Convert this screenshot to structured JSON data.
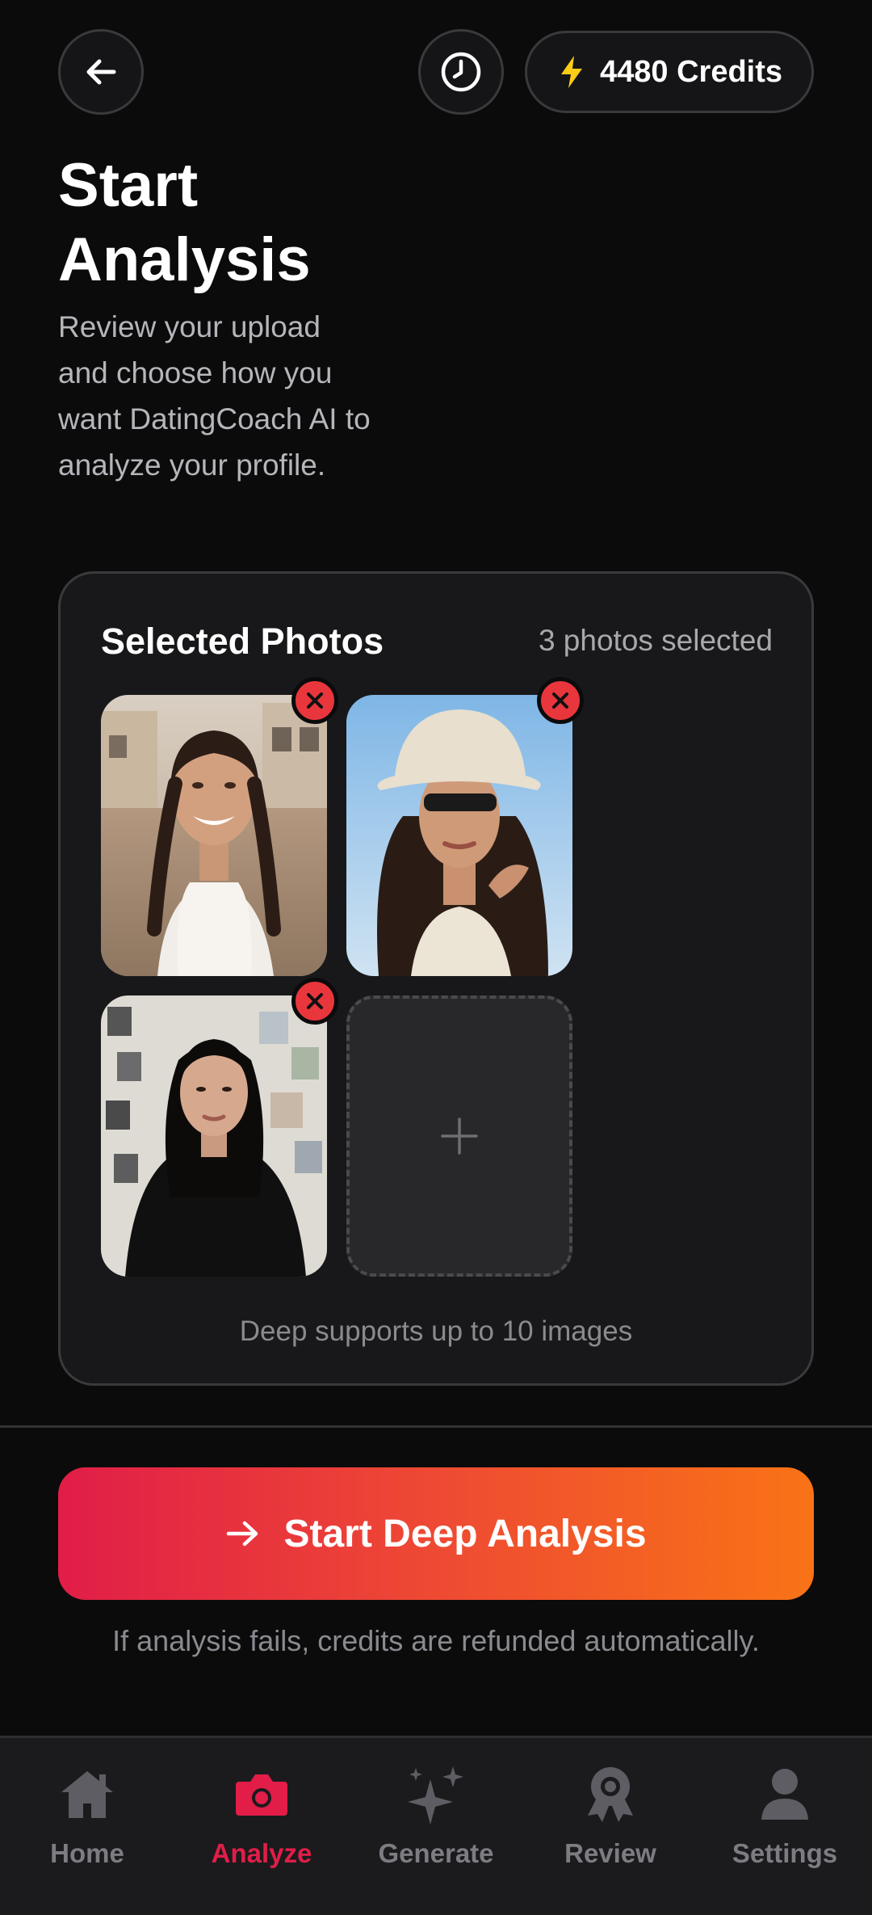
{
  "header": {
    "credits_label": "4480 Credits",
    "title": "Start Analysis",
    "subtitle": "Review your upload and choose how you want DatingCoach AI to analyze your profile."
  },
  "selected_photos": {
    "title": "Selected Photos",
    "count_label": "3 photos selected",
    "note": "Deep supports up to 10 images"
  },
  "cta": {
    "label": "Start Deep Analysis",
    "note": "If analysis fails, credits are refunded automatically."
  },
  "nav": {
    "items": [
      {
        "label": "Home",
        "icon": "home-icon",
        "active": false
      },
      {
        "label": "Analyze",
        "icon": "camera-icon",
        "active": true
      },
      {
        "label": "Generate",
        "icon": "sparkles-icon",
        "active": false
      },
      {
        "label": "Review",
        "icon": "award-icon",
        "active": false
      },
      {
        "label": "Settings",
        "icon": "user-icon",
        "active": false
      }
    ]
  },
  "colors": {
    "accent": "#e11d48",
    "gradient_end": "#f97316",
    "remove": "#e8363c",
    "bolt": "#facc15"
  }
}
